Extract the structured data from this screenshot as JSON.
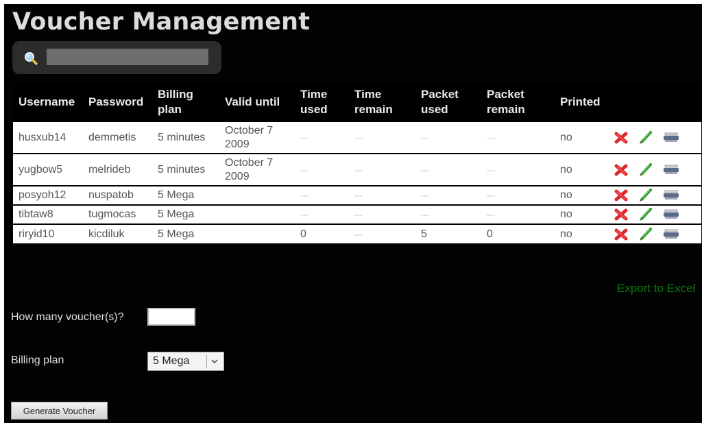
{
  "page": {
    "title": "Voucher Management"
  },
  "search": {
    "value": "",
    "icon": "search-icon"
  },
  "table": {
    "columns": {
      "username": "Username",
      "password": "Password",
      "billing_plan": "Billing plan",
      "valid_until": "Valid until",
      "time_used": "Time used",
      "time_remain": "Time remain",
      "packet_used": "Packet used",
      "packet_remain": "Packet remain",
      "printed": "Printed"
    },
    "rows": [
      {
        "username": "husxub14",
        "password": "demmetis",
        "billing_plan": "5 minutes",
        "valid_until": "October 7 2009",
        "time_used": "---",
        "time_remain": "---",
        "packet_used": "---",
        "packet_remain": "---",
        "printed": "no"
      },
      {
        "username": "yugbow5",
        "password": "melrideb",
        "billing_plan": "5 minutes",
        "valid_until": "October 7 2009",
        "time_used": "---",
        "time_remain": "---",
        "packet_used": "---",
        "packet_remain": "---",
        "printed": "no"
      },
      {
        "username": "posyoh12",
        "password": "nuspatob",
        "billing_plan": "5 Mega",
        "valid_until": "",
        "time_used": "---",
        "time_remain": "---",
        "packet_used": "---",
        "packet_remain": "---",
        "printed": "no"
      },
      {
        "username": "tibtaw8",
        "password": "tugmocas",
        "billing_plan": "5 Mega",
        "valid_until": "",
        "time_used": "---",
        "time_remain": "---",
        "packet_used": "---",
        "packet_remain": "---",
        "printed": "no"
      },
      {
        "username": "riryid10",
        "password": "kicdiluk",
        "billing_plan": "5 Mega",
        "valid_until": "",
        "time_used": "0",
        "time_remain": "---",
        "packet_used": "5",
        "packet_remain": "0",
        "printed": "no"
      }
    ],
    "row_actions": [
      "delete-icon",
      "edit-pencil-icon",
      "print-icon"
    ]
  },
  "export": {
    "label": "Export to Excel"
  },
  "form": {
    "count_label": "How many voucher(s)?",
    "count_value": "",
    "plan_label": "Billing plan",
    "plan_selected": "5 Mega",
    "generate_label": "Generate Voucher"
  },
  "colors": {
    "background": "#020202",
    "title": "#dcdcdc",
    "export_link": "#0b7a12",
    "delete": "#e0262a",
    "edit": "#2e9a2a",
    "print": "#5b6b86"
  }
}
